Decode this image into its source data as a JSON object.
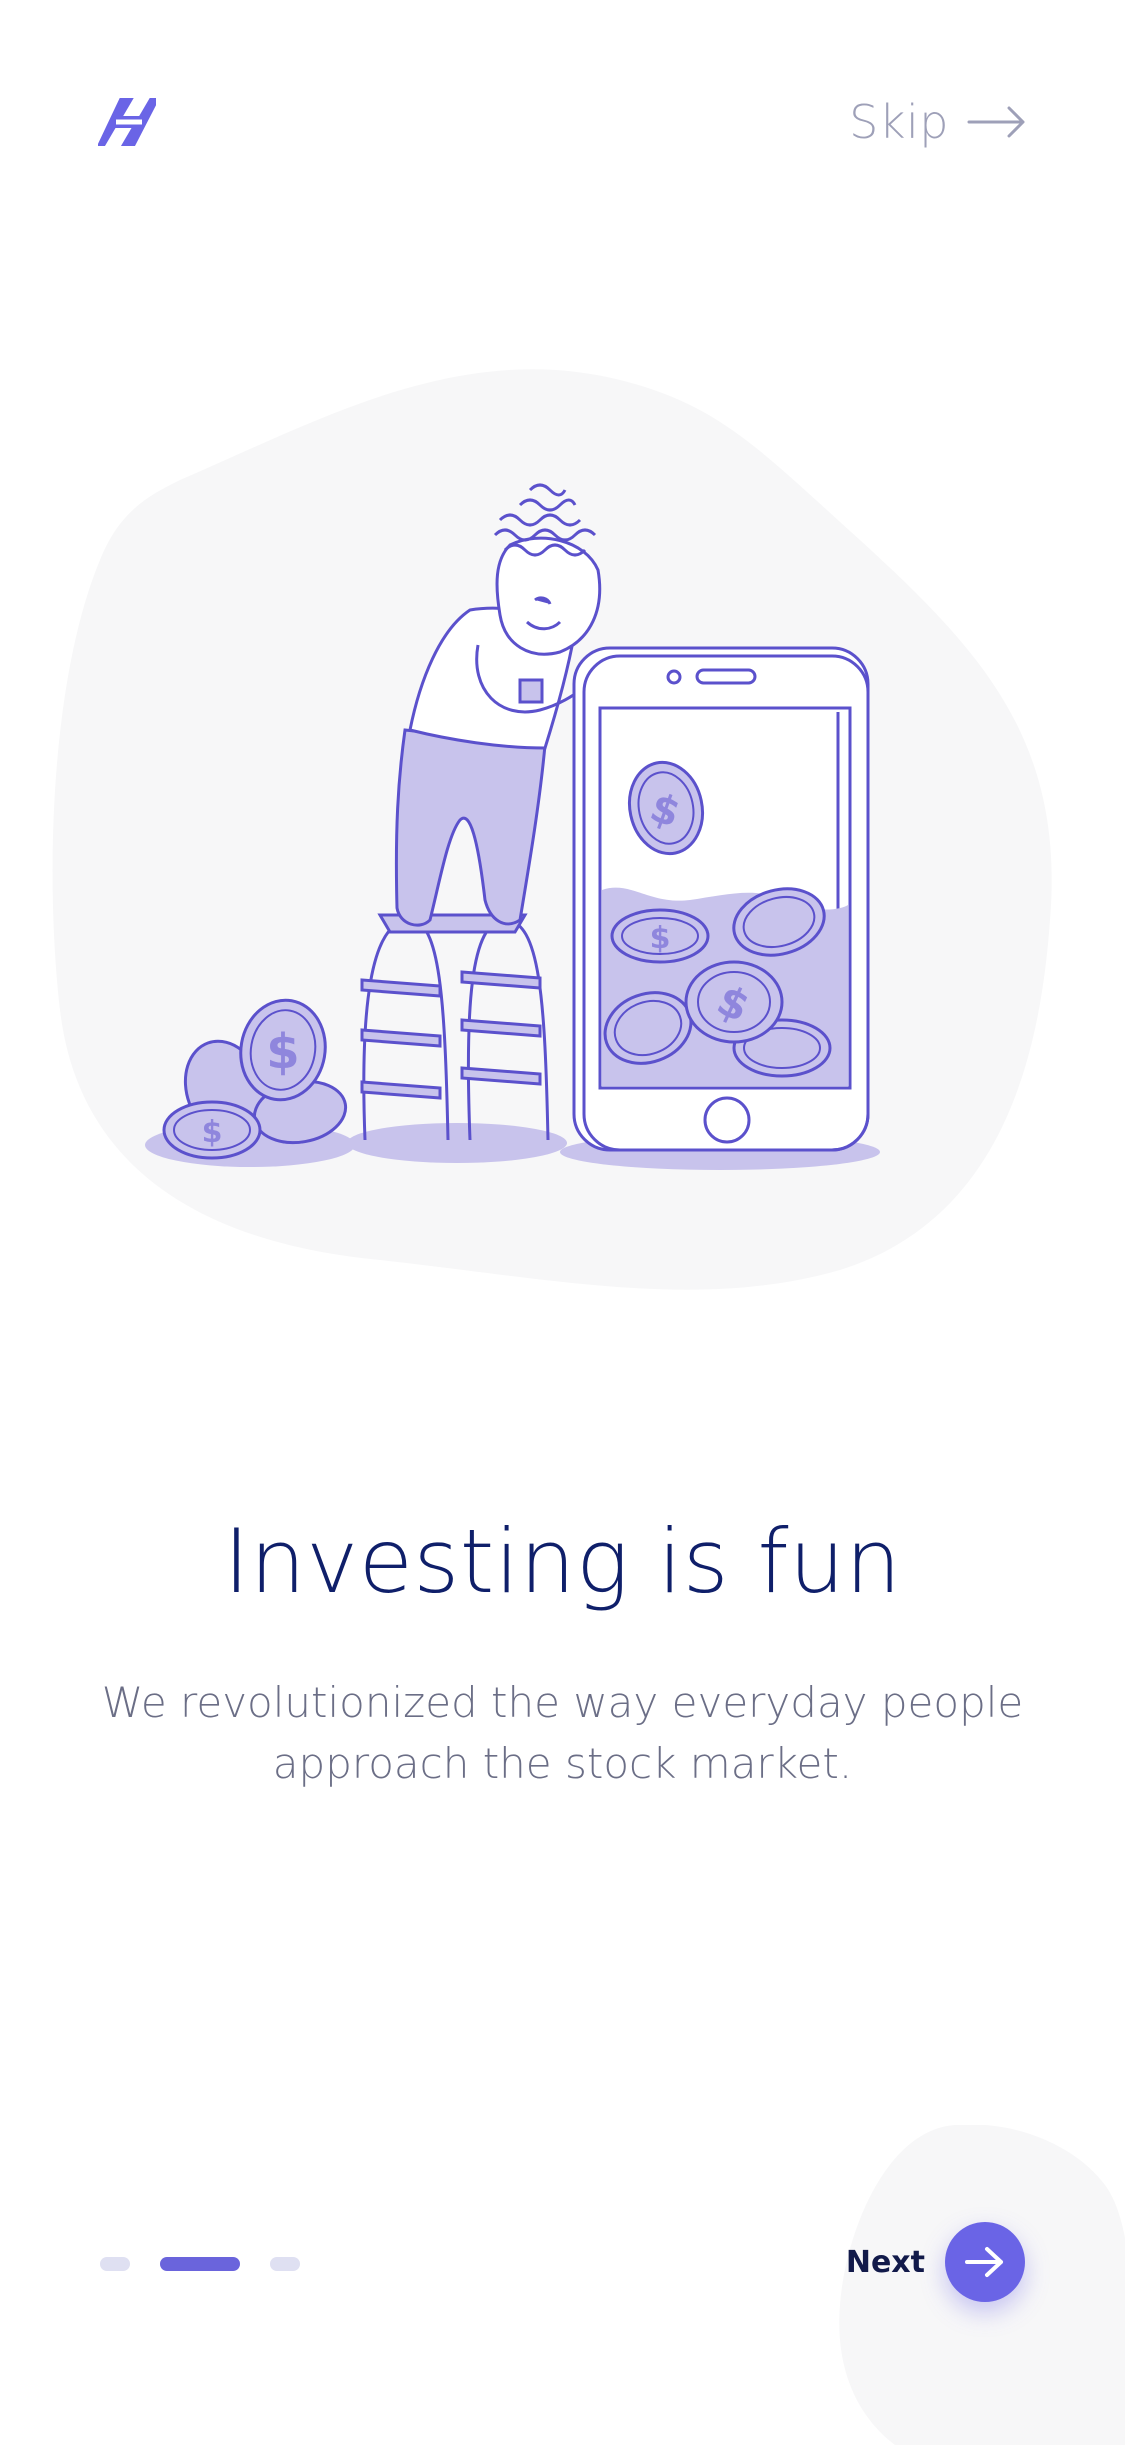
{
  "header": {
    "logo_icon": "app-logo-icon",
    "skip_label": "Skip",
    "skip_icon": "arrow-right-icon"
  },
  "illustration": {
    "coin_symbol": "$",
    "colors": {
      "primary": "#5b51cc",
      "fill": "#c8c3ec",
      "background_blob": "#f7f7f8"
    }
  },
  "onboarding": {
    "title": "Investing is fun",
    "subtitle": "We revolutionized the way everyday people approach the stock market.",
    "pagination": {
      "total": 3,
      "current": 2
    }
  },
  "footer": {
    "next_label": "Next",
    "next_icon": "arrow-right-icon"
  },
  "colors": {
    "accent": "#6a64e6",
    "title": "#0f1f6a",
    "body_text": "#6b6e86",
    "muted": "#9ea0b8",
    "dot_inactive": "#dfe0f2"
  }
}
